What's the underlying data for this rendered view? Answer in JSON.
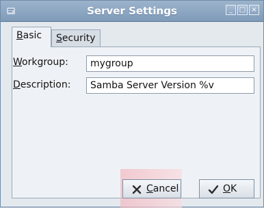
{
  "window": {
    "title": "Server Settings",
    "controls": {
      "minimize": "_",
      "maximize": "□",
      "close": "×"
    }
  },
  "tabs": [
    {
      "label": "Basic",
      "mnemonic": "B",
      "rest": "asic"
    },
    {
      "label": "Security",
      "mnemonic": "S",
      "rest": "ecurity"
    }
  ],
  "form": {
    "workgroup": {
      "label_mnemonic": "W",
      "label_rest": "orkgroup:",
      "value": "mygroup"
    },
    "description": {
      "label_mnemonic": "D",
      "label_rest": "escription:",
      "value": "Samba Server Version %v"
    }
  },
  "buttons": {
    "cancel": {
      "mnemonic": "C",
      "rest": "ancel",
      "icon": "cancel-x-icon"
    },
    "ok": {
      "mnemonic": "O",
      "rest": "K",
      "icon": "ok-check-icon"
    }
  }
}
